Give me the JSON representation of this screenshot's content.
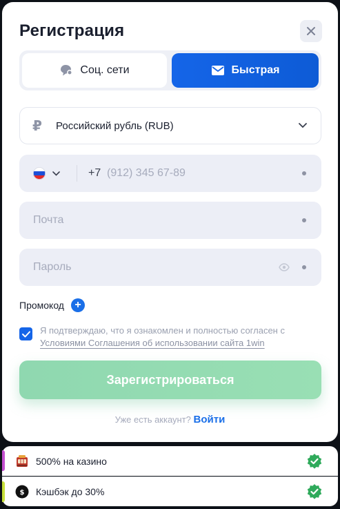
{
  "modal": {
    "title": "Регистрация",
    "tabs": [
      {
        "label": "Соц. сети",
        "icon": "chat-bubble-icon"
      },
      {
        "label": "Быстрая",
        "icon": "envelope-icon",
        "active": true
      }
    ]
  },
  "form": {
    "currency": {
      "symbol": "₽",
      "value": "Российский рубль (RUB)"
    },
    "phone": {
      "prefix": "+7",
      "placeholder": "(912) 345 67-89",
      "country_flag": "russia-flag-icon"
    },
    "email": {
      "placeholder": "Почта"
    },
    "password": {
      "placeholder": "Пароль"
    },
    "promo_label": "Промокод",
    "agreement_text": "Я подтверждаю, что я ознакомлен и полностью согласен с",
    "agreement_link": "Условиями Соглашения об использовании сайта 1win",
    "agreement_checked": true,
    "submit_label": "Зарегистрироваться",
    "login_prompt": "Уже есть аккаунт?",
    "login_link": "Войти"
  },
  "bonuses": [
    {
      "text": "500% на казино",
      "icon": "slot-machine-icon",
      "accent": "#c44fd0"
    },
    {
      "text": "Кэшбэк до 30%",
      "icon": "cashback-coin-icon",
      "accent": "#c8e03a"
    }
  ],
  "colors": {
    "primary": "#1565e8",
    "submit": "#93dbb2",
    "check_badge": "#2faa5b"
  }
}
